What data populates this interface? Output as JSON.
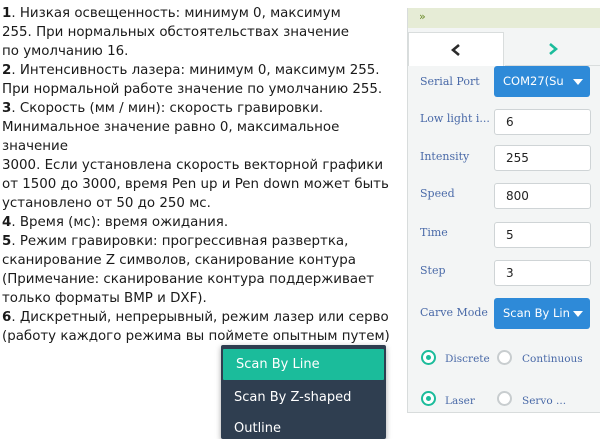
{
  "instructions": {
    "items": [
      {
        "num": "1",
        "lines": [
          "Низкая освещенность: минимум 0, максимум",
          "255. При нормальных обстоятельствах значение",
          "по умолчанию 16."
        ]
      },
      {
        "num": "2",
        "lines": [
          "Интенсивность лазера: минимум 0, максимум 255.",
          "При нормальной работе значение по умолчанию 255."
        ]
      },
      {
        "num": "3",
        "lines": [
          "Скорость (мм / мин): скорость гравировки.",
          "Минимальное значение равно 0, максимальное значение",
          "3000. Если установлена скорость векторной графики",
          "от 1500 до 3000, время Pen up и Pen down может быть",
          "установлено от 50 до 250 мс."
        ]
      },
      {
        "num": "4",
        "lines": [
          "Время (мс): время ожидания."
        ]
      },
      {
        "num": "5",
        "lines": [
          "Режим гравировки: прогрессивная развертка,",
          "сканирование Z символов, сканирование контура",
          "(Примечание: сканирование контура поддерживает",
          "только форматы BMP и DXF)."
        ]
      },
      {
        "num": "6",
        "lines": [
          "Дискретный, непрерывный, режим лазер или серво",
          "(работу каждого режима вы поймете опытным путем)"
        ]
      }
    ]
  },
  "carve_mode_menu": {
    "options": [
      "Scan By Line",
      "Scan By Z-shaped",
      "Outline"
    ],
    "highlighted": "Scan By Line"
  },
  "panel": {
    "collapse_glyph": "»",
    "tabs": {
      "back_icon": "chevron-left-icon",
      "forward_icon": "chevron-right-icon"
    },
    "serial_port": {
      "label": "Serial Port",
      "value": "COM27(Su"
    },
    "low_light": {
      "label": "Low light i...",
      "value": "6"
    },
    "intensity": {
      "label": "Intensity",
      "value": "255"
    },
    "speed": {
      "label": "Speed",
      "value": "800"
    },
    "time": {
      "label": "Time",
      "value": "5"
    },
    "step": {
      "label": "Step",
      "value": "3"
    },
    "carve_mode": {
      "label": "Carve Mode",
      "value": "Scan By Lin"
    },
    "radios": {
      "discrete": {
        "label": "Discrete",
        "checked": true
      },
      "continuous": {
        "label": "Continuous",
        "checked": false
      },
      "laser": {
        "label": "Laser",
        "checked": true
      },
      "servo": {
        "label": "Servo ...",
        "checked": false
      }
    }
  },
  "colors": {
    "accent_teal": "#1bbc9b",
    "button_blue": "#2e8ad8",
    "menu_bg": "#2f3e50",
    "label_blue": "#4a6aa8"
  }
}
